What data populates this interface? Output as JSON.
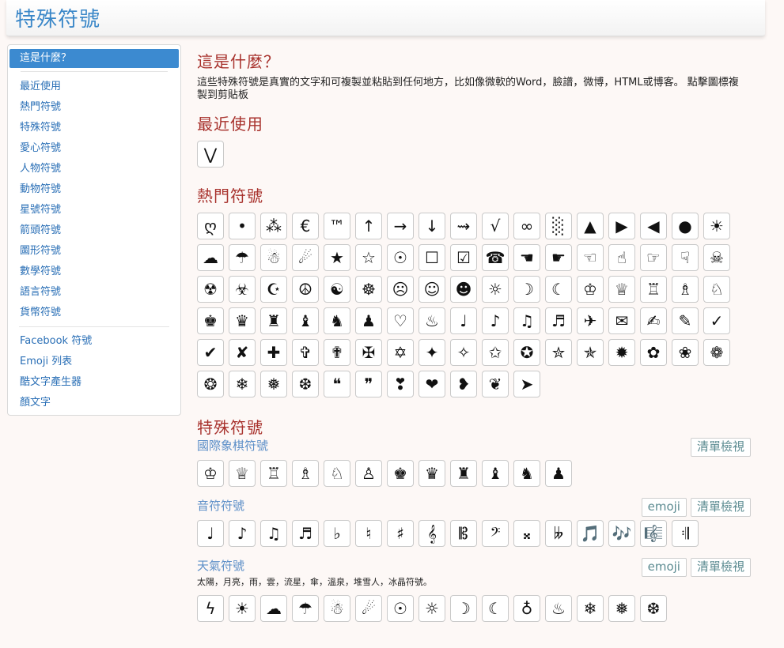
{
  "header": {
    "title": "特殊符號"
  },
  "sidebar": {
    "active": "這是什麼？",
    "items": [
      "最近使用",
      "熱門符號",
      "特殊符號",
      "愛心符號",
      "人物符號",
      "動物符號",
      "星號符號",
      "箭頭符號",
      "圖形符號",
      "數學符號",
      "語言符號",
      "貨幣符號"
    ],
    "links": [
      "Facebook 符號",
      "Emoji 列表",
      "酷文字產生器",
      "顏文字"
    ]
  },
  "main": {
    "what_title": "這是什麼？",
    "what_desc": "這些特殊符號是真實的文字和可複製並粘貼到任何地方，比如像微軟的Word，臉譜，微博，HTML或博客。 點擊圖標複製到剪貼板",
    "recent_title": "最近使用",
    "recent_symbols": [
      "⋁"
    ],
    "popular_title": "熱門符號",
    "popular_symbols": [
      "ღ",
      "•",
      "⁂",
      "€",
      "™",
      "↑",
      "→",
      "↓",
      "⇝",
      "√",
      "∞",
      "░",
      "▲",
      "▶",
      "◀",
      "●",
      "☀",
      "☁",
      "☂",
      "☃",
      "☄",
      "★",
      "☆",
      "☉",
      "☐",
      "☑",
      "☎",
      "☚",
      "☛",
      "☜",
      "☝",
      "☞",
      "☟",
      "☠",
      "☢",
      "☣",
      "☪",
      "☮",
      "☯",
      "☸",
      "☹",
      "☺",
      "☻",
      "☼",
      "☽",
      "☾",
      "♔",
      "♕",
      "♖",
      "♗",
      "♘",
      "♚",
      "♛",
      "♜",
      "♝",
      "♞",
      "♟",
      "♡",
      "♨",
      "♩",
      "♪",
      "♫",
      "♬",
      "✈",
      "✉",
      "✍",
      "✎",
      "✓",
      "✔",
      "✘",
      "✚",
      "✞",
      "✟",
      "✠",
      "✡",
      "✦",
      "✧",
      "✩",
      "✪",
      "✮",
      "✯",
      "✹",
      "✿",
      "❀",
      "❁",
      "❂",
      "❄",
      "❅",
      "❆",
      "❝",
      "❞",
      "❣",
      "❤",
      "❥",
      "❦",
      "➤"
    ],
    "special_title": "特殊符號",
    "sections": [
      {
        "title": "國際象棋符號",
        "buttons": [
          "清單檢視"
        ],
        "desc": "",
        "symbols": [
          "♔",
          "♕",
          "♖",
          "♗",
          "♘",
          "♙",
          "♚",
          "♛",
          "♜",
          "♝",
          "♞",
          "♟"
        ]
      },
      {
        "title": "音符符號",
        "buttons": [
          "emoji",
          "清單檢視"
        ],
        "desc": "",
        "symbols": [
          "♩",
          "♪",
          "♫",
          "♬",
          "♭",
          "♮",
          "♯",
          "𝄞",
          "𝄡",
          "𝄢",
          "𝄪",
          "𝄫",
          "🎵",
          "🎶",
          "🎼",
          "𝄇"
        ]
      },
      {
        "title": "天氣符號",
        "buttons": [
          "emoji",
          "清單檢視"
        ],
        "desc": "太陽，月亮，雨，雲，流星，傘，溫泉，堆雪人，冰晶符號。",
        "symbols": [
          "ϟ",
          "☀",
          "☁",
          "☂",
          "☃",
          "☄",
          "☉",
          "☼",
          "☽",
          "☾",
          "♁",
          "♨",
          "❄",
          "❅",
          "❆"
        ]
      }
    ]
  }
}
